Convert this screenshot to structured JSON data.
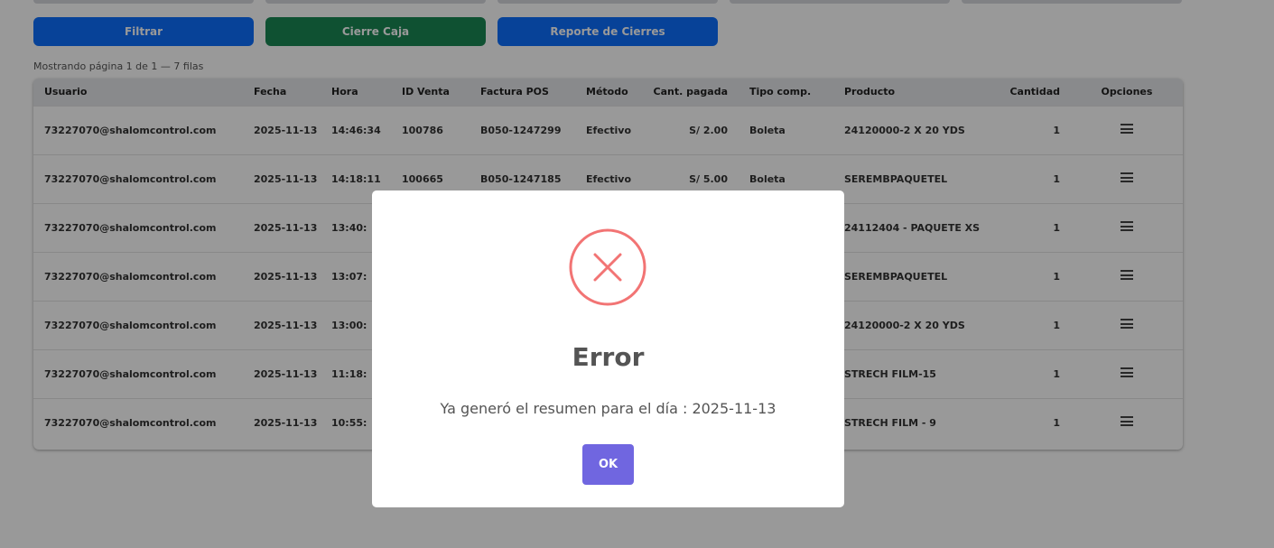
{
  "toolbar": {
    "filter_label": "Filtrar",
    "close_cash_label": "Cierre Caja",
    "report_label": "Reporte de Cierres"
  },
  "colors": {
    "filter": "#0d6efd",
    "close_cash": "#198754",
    "report": "#0d6efd",
    "ok_button": "#7066e0",
    "error_icon": "#f27474"
  },
  "pagination": {
    "summary": "Mostrando página 1 de 1 — 7 filas"
  },
  "table": {
    "headers": [
      "Usuario",
      "Fecha",
      "Hora",
      "ID Venta",
      "Factura POS",
      "Método",
      "Cant. pagada",
      "Tipo comp.",
      "Producto",
      "Cantidad",
      "Opciones"
    ],
    "rows": [
      {
        "usuario": "73227070@shalomcontrol.com",
        "fecha": "2025-11-13",
        "hora": "14:46:34",
        "id_venta": "100786",
        "factura": "B050-1247299",
        "metodo": "Efectivo",
        "pagada": "S/ 2.00",
        "tipo": "Boleta",
        "producto": "24120000-2 X 20 YDS",
        "cantidad": "1"
      },
      {
        "usuario": "73227070@shalomcontrol.com",
        "fecha": "2025-11-13",
        "hora": "14:18:11",
        "id_venta": "100665",
        "factura": "B050-1247185",
        "metodo": "Efectivo",
        "pagada": "S/ 5.00",
        "tipo": "Boleta",
        "producto": "SEREMBPAQUETEL",
        "cantidad": "1"
      },
      {
        "usuario": "73227070@shalomcontrol.com",
        "fecha": "2025-11-13",
        "hora": "13:40:",
        "id_venta": "",
        "factura": "",
        "metodo": "",
        "pagada": "",
        "tipo": "",
        "producto": "24112404 - PAQUETE XS",
        "cantidad": "1"
      },
      {
        "usuario": "73227070@shalomcontrol.com",
        "fecha": "2025-11-13",
        "hora": "13:07:",
        "id_venta": "",
        "factura": "",
        "metodo": "",
        "pagada": "",
        "tipo": "",
        "producto": "SEREMBPAQUETEL",
        "cantidad": "1"
      },
      {
        "usuario": "73227070@shalomcontrol.com",
        "fecha": "2025-11-13",
        "hora": "13:00:",
        "id_venta": "",
        "factura": "",
        "metodo": "",
        "pagada": "",
        "tipo": "",
        "producto": "24120000-2 X 20 YDS",
        "cantidad": "1"
      },
      {
        "usuario": "73227070@shalomcontrol.com",
        "fecha": "2025-11-13",
        "hora": "11:18:",
        "id_venta": "",
        "factura": "",
        "metodo": "",
        "pagada": "",
        "tipo": "",
        "producto": "STRECH FILM-15",
        "cantidad": "1"
      },
      {
        "usuario": "73227070@shalomcontrol.com",
        "fecha": "2025-11-13",
        "hora": "10:55:",
        "id_venta": "",
        "factura": "",
        "metodo": "",
        "pagada": "",
        "tipo": "",
        "producto": "STRECH FILM - 9",
        "cantidad": "1"
      }
    ]
  },
  "modal": {
    "icon": "error-x-icon",
    "title": "Error",
    "message": "Ya generó el resumen para el día : 2025-11-13",
    "ok_label": "OK"
  }
}
